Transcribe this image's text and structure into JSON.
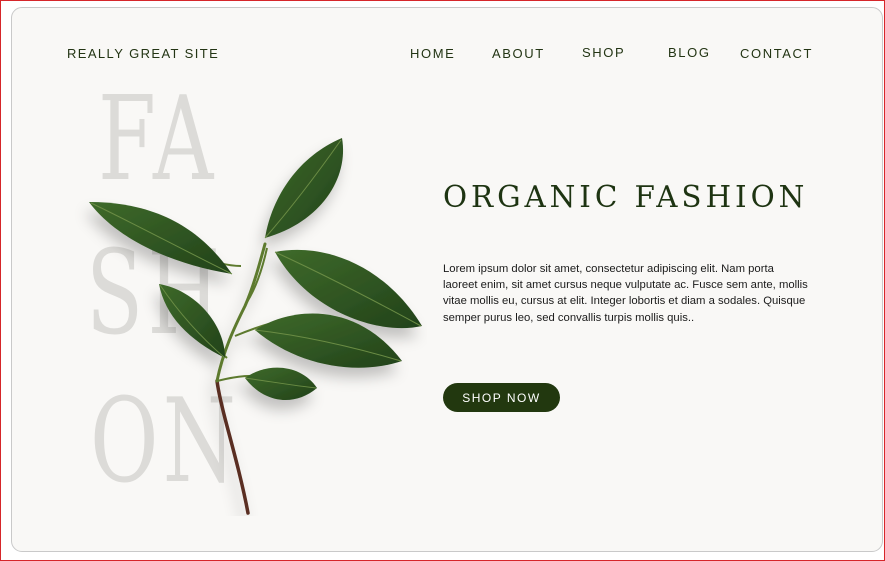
{
  "header": {
    "brand": "REALLY GREAT SITE",
    "nav": [
      "HOME",
      "ABOUT",
      "SHOP",
      "BLOG",
      "CONTACT"
    ]
  },
  "hero": {
    "background_word_lines": [
      "FA",
      "SH",
      "ON"
    ],
    "headline": "ORGANIC FASHION",
    "body": "Lorem ipsum dolor sit amet, consectetur adipiscing elit. Nam porta laoreet enim, sit amet cursus neque vulputate ac. Fusce sem ante, mollis vitae mollis eu, cursus at elit. Integer lobortis et diam a sodales. Quisque semper purus leo, sed convallis turpis mollis quis..",
    "cta_label": "SHOP NOW",
    "image_icon": "leaf-branch"
  },
  "colors": {
    "accent": "#22380f",
    "text_dark": "#233514",
    "background": "#f9f8f6",
    "bg_word": "#dcdbd8"
  }
}
